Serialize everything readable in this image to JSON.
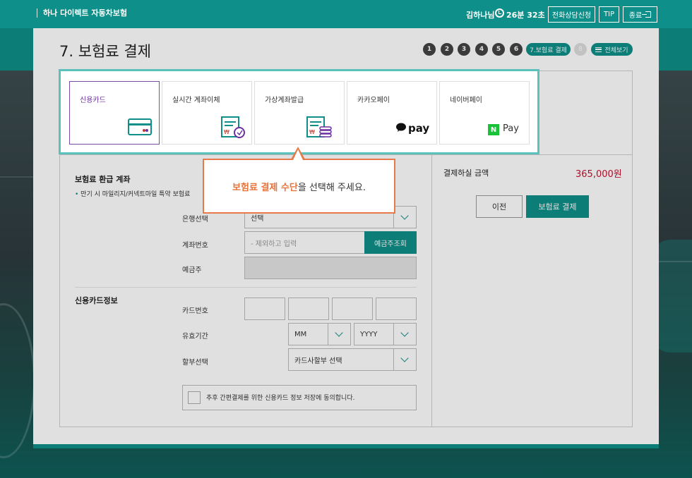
{
  "header": {
    "brand": "하나 다이렉트 자동차보험",
    "user": "김하나님",
    "timer": "26분 32초",
    "consult_label": "전화상담신청",
    "tip_label": "TIP",
    "exit_label": "종료"
  },
  "page": {
    "title": "7. 보험료 결제",
    "steps": [
      "1",
      "2",
      "3",
      "4",
      "5",
      "6"
    ],
    "current_step": "7.보험료 결제",
    "next_step": "8",
    "view_all_label": "전체보기"
  },
  "payment_methods": [
    {
      "label": "신용카드",
      "icon": "credit-card-icon"
    },
    {
      "label": "실시간 계좌이체",
      "icon": "transfer-icon"
    },
    {
      "label": "가상계좌발급",
      "icon": "virtual-account-icon"
    },
    {
      "label": "카카오페이",
      "icon": "kakaopay-logo",
      "logo_text": "pay"
    },
    {
      "label": "네이버페이",
      "icon": "naverpay-logo",
      "logo_badge": "N",
      "logo_text": "Pay"
    }
  ],
  "refund": {
    "title": "보험료 환급 계좌",
    "note": "만기 시 마일리지/커넥트마일 특약 보험료",
    "bank_label": "은행선택",
    "bank_value": "선택",
    "account_label": "계좌번호",
    "account_placeholder": "- 제외하고 입력",
    "lookup_label": "예금주조회",
    "holder_label": "예금주"
  },
  "card": {
    "title": "신용카드정보",
    "number_label": "카드번호",
    "expiry_label": "유효기간",
    "month_value": "MM",
    "year_value": "YYYY",
    "install_label": "할부선택",
    "install_value": "카드사할부 선택",
    "agree_text": "추후 간편결제를 위한 신용카드 정보 저장에 동의합니다."
  },
  "summary": {
    "amount_label": "결제하실 금액",
    "amount_value": "365,000원",
    "prev_label": "이전",
    "pay_label": "보험료 결제"
  },
  "tooltip": {
    "highlight": "보험료 결제 수단",
    "rest": "을 선택해 주세요."
  },
  "colors": {
    "brand": "#0f8f89",
    "highlight_border": "#5ac2bd",
    "tooltip_accent": "#e8733a",
    "amount": "#c8102e",
    "active_method": "#7c4ba8"
  }
}
